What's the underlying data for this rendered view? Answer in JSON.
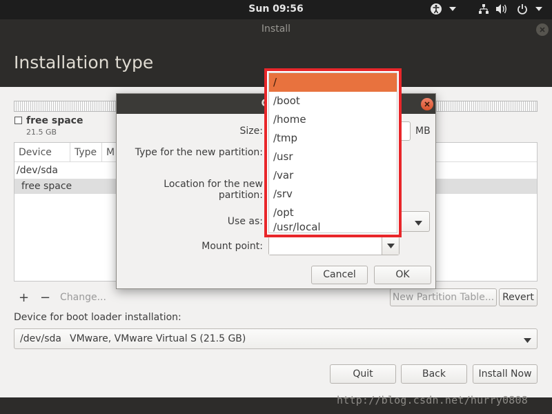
{
  "topbar": {
    "clock": "Sun 09:56",
    "icons": [
      "accessibility-icon",
      "network-icon",
      "volume-icon",
      "power-icon"
    ]
  },
  "window": {
    "title": "Install",
    "page_title": "Installation type"
  },
  "partition": {
    "label": "free space",
    "size": "21.5 GB"
  },
  "table": {
    "headers": [
      "Device",
      "Type",
      "M"
    ],
    "rows": [
      "/dev/sda",
      "free space"
    ]
  },
  "actions": {
    "add": "+",
    "remove": "−",
    "change": "Change...",
    "new_table": "New Partition Table...",
    "revert": "Revert"
  },
  "bootloader": {
    "label": "Device for boot loader installation:",
    "device": "/dev/sda",
    "name": "VMware, VMware Virtual S (21.5 GB)"
  },
  "footer": {
    "quit": "Quit",
    "back": "Back",
    "install": "Install Now"
  },
  "watermark": "http://blog.csdn.net/hurry0808",
  "dialog": {
    "title": "Creat",
    "size_label": "Size:",
    "size_unit": "MB",
    "type_label": "Type for the new partition:",
    "location_label": "Location for the new partition:",
    "use_label": "Use as:",
    "mount_label": "Mount point:",
    "cancel": "Cancel",
    "ok": "OK"
  },
  "mount_options": {
    "selected": "/",
    "items": [
      "/boot",
      "/home",
      "/tmp",
      "/usr",
      "/var",
      "/srv",
      "/opt",
      "/usr/local"
    ]
  },
  "colors": {
    "highlight_frame": "#e8262a",
    "selected_option": "#e8723e",
    "header_bg": "#2d2c2a"
  }
}
